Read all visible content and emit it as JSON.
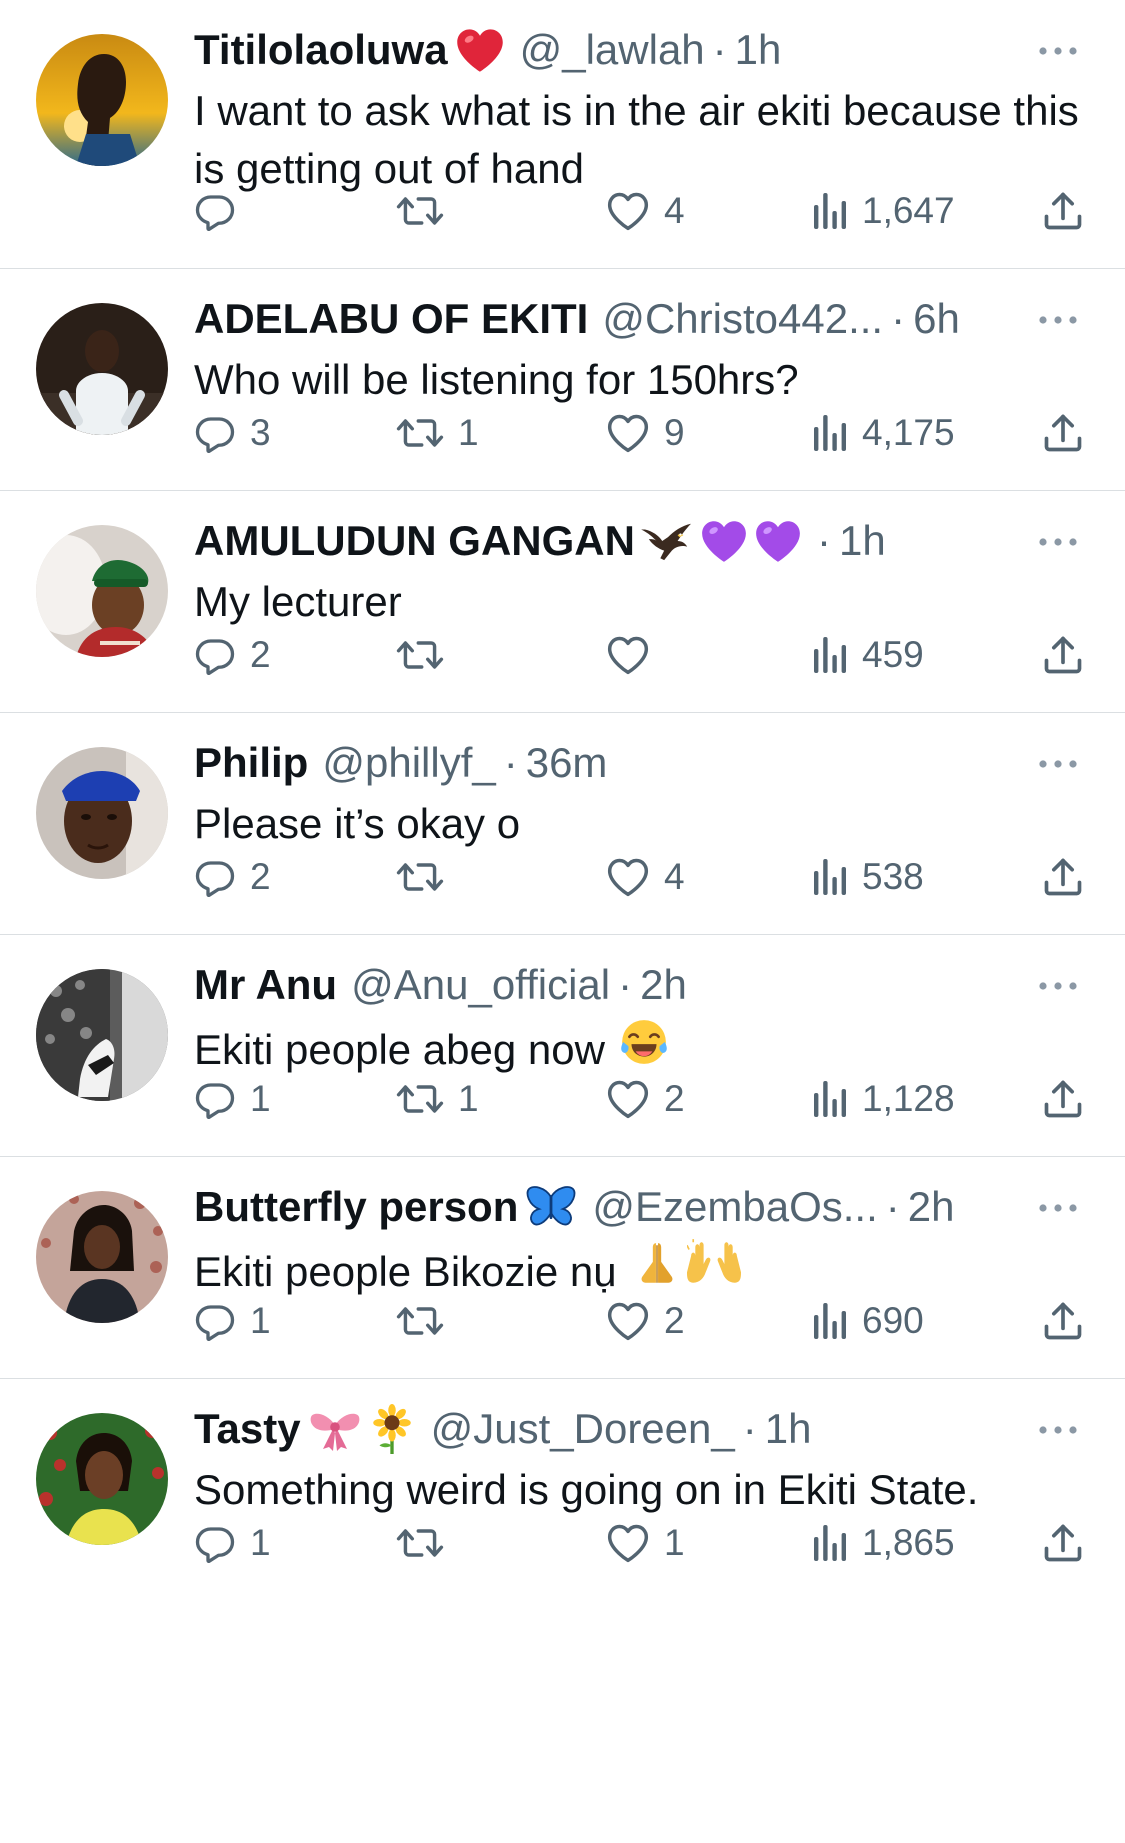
{
  "tweets": [
    {
      "name": "Titilolaoluwa",
      "name_emojis": [
        "red-heart"
      ],
      "handle": "@_lawlah",
      "time": "1h",
      "text": "I want to ask what is in the air ekiti because this is getting out of hand",
      "text_emojis": [],
      "replies": "",
      "retweets": "",
      "likes": "4",
      "views": "1,647"
    },
    {
      "name": "ADELABU OF EKITI",
      "name_emojis": [],
      "handle": "@Christo442...",
      "time": "6h",
      "text": "Who will be listening for 150hrs?",
      "text_emojis": [],
      "replies": "3",
      "retweets": "1",
      "likes": "9",
      "views": "4,175"
    },
    {
      "name": "AMULUDUN GANGAN",
      "name_emojis": [
        "eagle",
        "purple-heart",
        "purple-heart"
      ],
      "handle": "",
      "time": "1h",
      "text": "My lecturer",
      "text_emojis": [],
      "replies": "2",
      "retweets": "",
      "likes": "",
      "views": "459"
    },
    {
      "name": "Philip",
      "name_emojis": [],
      "handle": "@phillyf_",
      "time": "36m",
      "text": "Please it’s okay o",
      "text_emojis": [],
      "replies": "2",
      "retweets": "",
      "likes": "4",
      "views": "538"
    },
    {
      "name": "Mr Anu",
      "name_emojis": [],
      "handle": "@Anu_official",
      "time": "2h",
      "text": "Ekiti people abeg now",
      "text_emojis": [
        "tears-of-joy"
      ],
      "replies": "1",
      "retweets": "1",
      "likes": "2",
      "views": "1,128"
    },
    {
      "name": "Butterfly person",
      "name_emojis": [
        "butterfly"
      ],
      "handle": "@EzembaOs...",
      "time": "2h",
      "text": "Ekiti people Bikozie nụ",
      "text_emojis": [
        "folded-hands",
        "raising-hands"
      ],
      "replies": "1",
      "retweets": "",
      "likes": "2",
      "views": "690"
    },
    {
      "name": "Tasty",
      "name_emojis": [
        "ribbon",
        "sunflower"
      ],
      "handle": "@Just_Doreen_",
      "time": "1h",
      "text": "Something weird is going on in Ekiti State.",
      "text_emojis": [],
      "replies": "1",
      "retweets": "",
      "likes": "1",
      "views": "1,865"
    }
  ],
  "colors": {
    "text_primary": "#0f1419",
    "text_secondary": "#536471",
    "divider": "#dbdfe2",
    "background": "#ffffff"
  },
  "icons": {
    "reply": "reply-icon",
    "retweet": "retweet-icon",
    "like": "heart-icon",
    "views": "views-icon",
    "share": "share-icon",
    "more": "more-icon"
  }
}
